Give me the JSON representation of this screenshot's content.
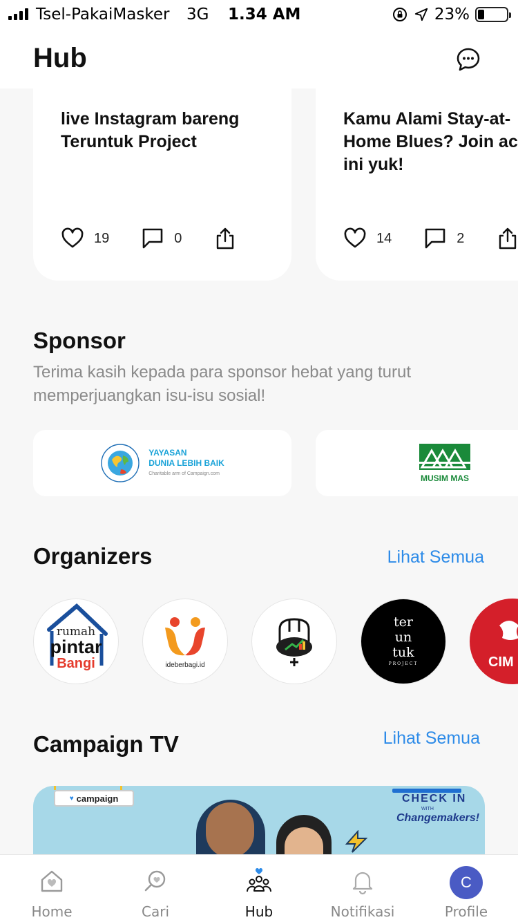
{
  "status_bar": {
    "carrier": "Tsel-PakaiMasker",
    "network": "3G",
    "time": "1.34 AM",
    "battery": "23%",
    "battery_level": 0.23
  },
  "header": {
    "title": "Hub"
  },
  "campaign_cards": [
    {
      "title": "live Instagram bareng Teruntuk Project",
      "likes": "19",
      "comments": "0"
    },
    {
      "title": "Kamu Alami Stay-at-Home Blues? Join acara ini yuk!",
      "likes": "14",
      "comments": "2"
    }
  ],
  "sponsor": {
    "title": "Sponsor",
    "description": "Terima kasih kepada para sponsor hebat yang turut memperjuangkan isu-isu sosial!",
    "items": [
      {
        "logo": "yayasan-dunia-lebih-baik-logo",
        "line1": "YAYASAN",
        "line2": "DUNIA LEBIH BAIK",
        "line3": "Charitable arm of Campaign.com"
      },
      {
        "logo": "musim-mas-logo",
        "name": "MUSIM MAS"
      }
    ]
  },
  "organizers": {
    "title": "Organizers",
    "see_all": "Lihat Semua",
    "items": [
      {
        "name": "rumah-pintar-bangi",
        "l1": "rumah",
        "l2": "pintar",
        "l3": "Bangi"
      },
      {
        "name": "ideberbagi",
        "text": "ideberbagi.id"
      },
      {
        "name": "organizer-3"
      },
      {
        "name": "teruntuk-project",
        "l1": "ter",
        "l2": "un",
        "l3": "tuk",
        "l4": "PROJECT"
      },
      {
        "name": "cimb",
        "text": "CIM"
      }
    ]
  },
  "campaign_tv": {
    "title": "Campaign TV",
    "see_all": "Lihat Semua",
    "badge": "campaign",
    "check_in": "CHECK IN",
    "with": "WITH",
    "changemakers": "Changemakers!"
  },
  "tabbar": {
    "items": [
      {
        "label": "Home",
        "icon": "home-icon"
      },
      {
        "label": "Cari",
        "icon": "search-icon"
      },
      {
        "label": "Hub",
        "icon": "hub-icon"
      },
      {
        "label": "Notifikasi",
        "icon": "bell-icon"
      },
      {
        "label": "Profile",
        "icon": "avatar",
        "initial": "C"
      }
    ],
    "active_color": "#111111",
    "inactive_color": "#888888"
  },
  "colors": {
    "accent": "#2d8be8",
    "avatar": "#4a5bc4"
  }
}
